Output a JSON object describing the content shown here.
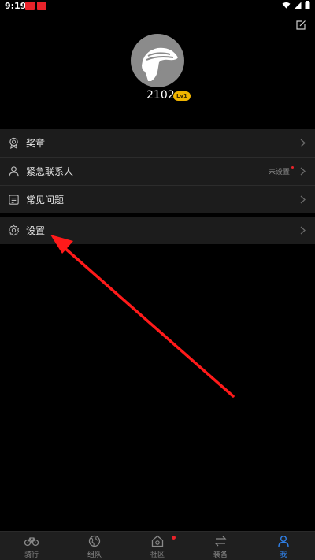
{
  "status_bar": {
    "time": "9:19"
  },
  "profile": {
    "name": "2102",
    "level": "Lv1"
  },
  "menu": {
    "medals": {
      "label": "奖章"
    },
    "emergency_contact": {
      "label": "紧急联系人",
      "status": "未设置"
    },
    "faq": {
      "label": "常见问题"
    },
    "settings": {
      "label": "设置"
    }
  },
  "tabs": [
    {
      "label": "骑行",
      "icon": "bicycle-icon"
    },
    {
      "label": "组队",
      "icon": "globe-icon"
    },
    {
      "label": "社区",
      "icon": "community-home-icon"
    },
    {
      "label": "装备",
      "icon": "equipment-sort-icon"
    },
    {
      "label": "我",
      "icon": "person-icon",
      "active": true
    }
  ],
  "colors": {
    "accent": "#2f7fe6",
    "badge": "#f0b400",
    "annotation_arrow": "#ff1a1a",
    "dot": "#e8232a"
  }
}
